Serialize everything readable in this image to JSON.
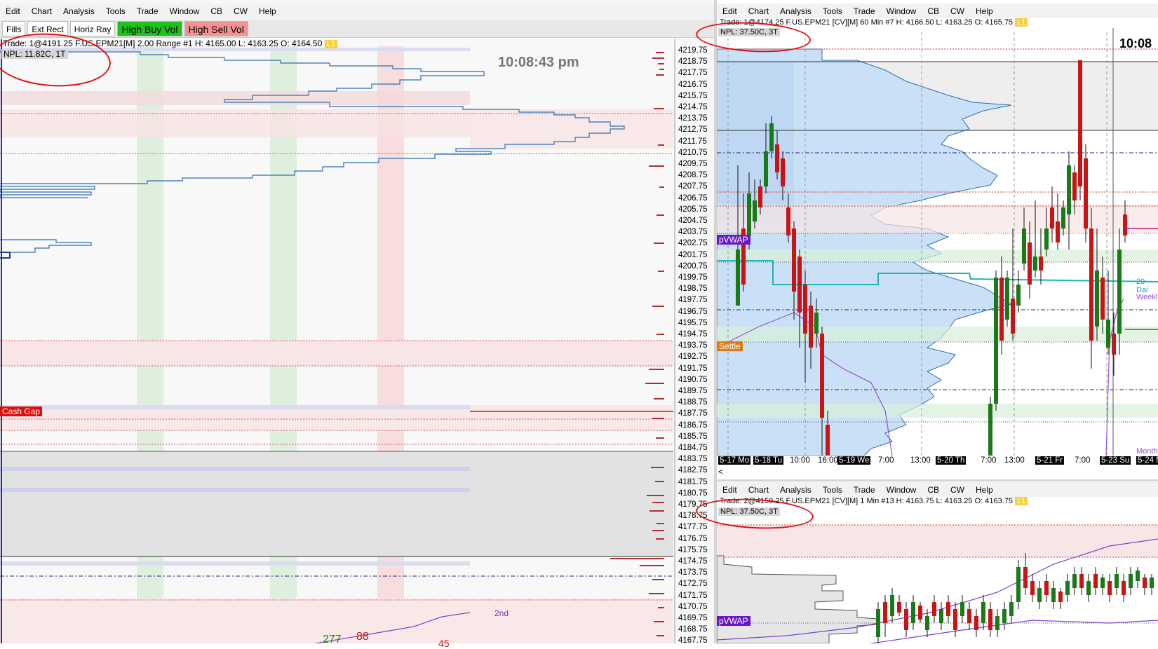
{
  "left_window": {
    "menu": [
      "Edit",
      "Chart",
      "Analysis",
      "Tools",
      "Trade",
      "Window",
      "CB",
      "CW",
      "Help"
    ],
    "toolbar": {
      "fills": "Fills",
      "ext_rect": "Ext Rect",
      "horiz_ray": "Horiz Ray",
      "high_buy_vol": "High Buy Vol",
      "high_sell_vol": "High Sell Vol"
    },
    "info_line": "Trade: 1@4191.25  F.US.EPM21[M]  2.00 Range  #1 H: 4165.00 L: 4163.25 O: 4164.50",
    "badge": "L1",
    "npl": "NPL: 11.82C, 1T",
    "clock": "10:08:43 pm",
    "price_axis": [
      "4219.75",
      "4218.75",
      "4217.75",
      "4216.75",
      "4215.75",
      "4214.75",
      "4213.75",
      "4212.75",
      "4211.75",
      "4210.75",
      "4209.75",
      "4208.75",
      "4207.75",
      "4206.75",
      "4205.75",
      "4204.75",
      "4203.75",
      "4202.75",
      "4201.75",
      "4200.75",
      "4199.75",
      "4198.75",
      "4197.75",
      "4196.75",
      "4195.75",
      "4194.75",
      "4193.75",
      "4192.75",
      "4191.75",
      "4190.75",
      "4189.75",
      "4188.75",
      "4187.75",
      "4186.75",
      "4185.75",
      "4184.75",
      "4183.75",
      "4182.75",
      "4181.75",
      "4180.75",
      "4179.75",
      "4178.75",
      "4177.75",
      "4176.75",
      "4175.75",
      "4174.75",
      "4173.75",
      "4172.75",
      "4171.75",
      "4170.75",
      "4169.75",
      "4168.75",
      "4167.75"
    ],
    "cash_gap": "Cash Gap",
    "label_2nd": "2nd",
    "bottom_numbers": [
      "277",
      "88",
      "45"
    ]
  },
  "right_top_window": {
    "menu": [
      "Edit",
      "Chart",
      "Analysis",
      "Tools",
      "Trade",
      "Window",
      "CB",
      "CW",
      "Help"
    ],
    "info_line": "Trade: 1@4174.25  F.US.EPM21 [CV][M]  60 Min  #7 H: 4166.50 L: 4163.25 O: 4165.75",
    "badge": "L1",
    "npl": "NPL: 37.50C, 3T",
    "clock": "10:08",
    "tags": {
      "pvwap": "pVWAP",
      "settle": "Settle",
      "daily": "20 Dai",
      "weekly": "Weekl",
      "monthly": "Month"
    },
    "x_axis": [
      {
        "t": "5-17 Mo",
        "dark": true
      },
      {
        "t": "5-18 Tu",
        "dark": true
      },
      {
        "t": "10:00",
        "dark": false
      },
      {
        "t": "16:00",
        "dark": false
      },
      {
        "t": "5-19 We",
        "dark": true
      },
      {
        "t": "7:00",
        "dark": false
      },
      {
        "t": "13:00",
        "dark": false
      },
      {
        "t": "5-20 Th",
        "dark": true
      },
      {
        "t": "7:00",
        "dark": false
      },
      {
        "t": "13:00",
        "dark": false
      },
      {
        "t": "5-21 Fr",
        "dark": true
      },
      {
        "t": "7:00",
        "dark": false
      },
      {
        "t": "5-23 Su",
        "dark": true
      },
      {
        "t": "5-24 M",
        "dark": true
      }
    ],
    "scroll_arrow": "<"
  },
  "right_bottom_window": {
    "menu": [
      "Edit",
      "Chart",
      "Analysis",
      "Tools",
      "Trade",
      "Window",
      "CB",
      "CW",
      "Help"
    ],
    "info_line": "Trade: 2@4150.25  F.US.EPM21 [CV][M]  1 Min  #13 H: 4163.75 L: 4163.25 O: 4163.75",
    "badge": "L1",
    "npl": "NPL: 37.50C, 3T",
    "pvwap": "pVWAP"
  },
  "colors": {
    "buy_green": "#1ec01e",
    "sell_red": "#f39292",
    "candle_up": "#1a7a1a",
    "candle_down": "#c81414",
    "profile_blue": "#2b6fb3",
    "vwap_cyan": "#1fb3b3",
    "purple": "#8a3fc0",
    "annotation_red": "#e01010"
  }
}
